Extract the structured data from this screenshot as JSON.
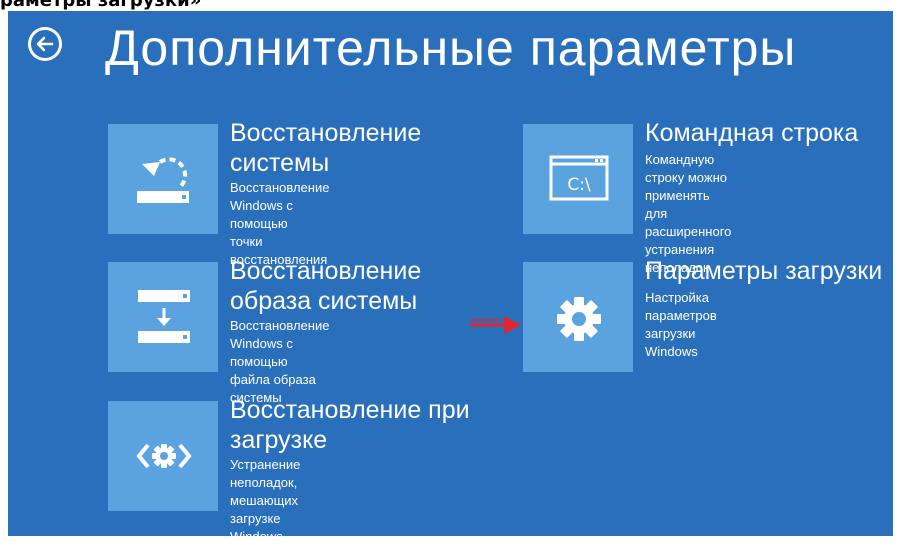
{
  "caption": "раметры загрузки»",
  "title": "Дополнительные параметры",
  "icons": {
    "back": "back-arrow-icon"
  },
  "colors": {
    "background": "#2a6fbc",
    "tile": "#5aa3de",
    "text": "#ffffff",
    "arrow": "#e0262f"
  },
  "tiles": [
    {
      "title_lines": [
        "Восстановление",
        "системы"
      ],
      "description_lines": [
        "Восстановление Windows с помощью",
        "точки восстановления"
      ],
      "icon": "system-restore-icon"
    },
    {
      "title_lines": [
        "Командная строка"
      ],
      "description_lines": [
        "Командную строку можно применять",
        "для расширенного устранения",
        "неполадок"
      ],
      "icon": "command-prompt-icon",
      "icon_text": "C:\\"
    },
    {
      "title_lines": [
        "Восстановление",
        "образа системы"
      ],
      "description_lines": [
        "Восстановление Windows с помощью",
        "файла образа системы"
      ],
      "icon": "system-image-recovery-icon"
    },
    {
      "title_lines": [
        "Параметры загрузки"
      ],
      "description_lines": [
        "Настройка параметров загрузки",
        "Windows"
      ],
      "icon": "gear-icon"
    },
    {
      "title_lines": [
        "Восстановление при",
        "загрузке"
      ],
      "description_lines": [
        "Устранение неполадок, мешающих",
        "загрузке Windows"
      ],
      "icon": "startup-repair-icon"
    }
  ]
}
